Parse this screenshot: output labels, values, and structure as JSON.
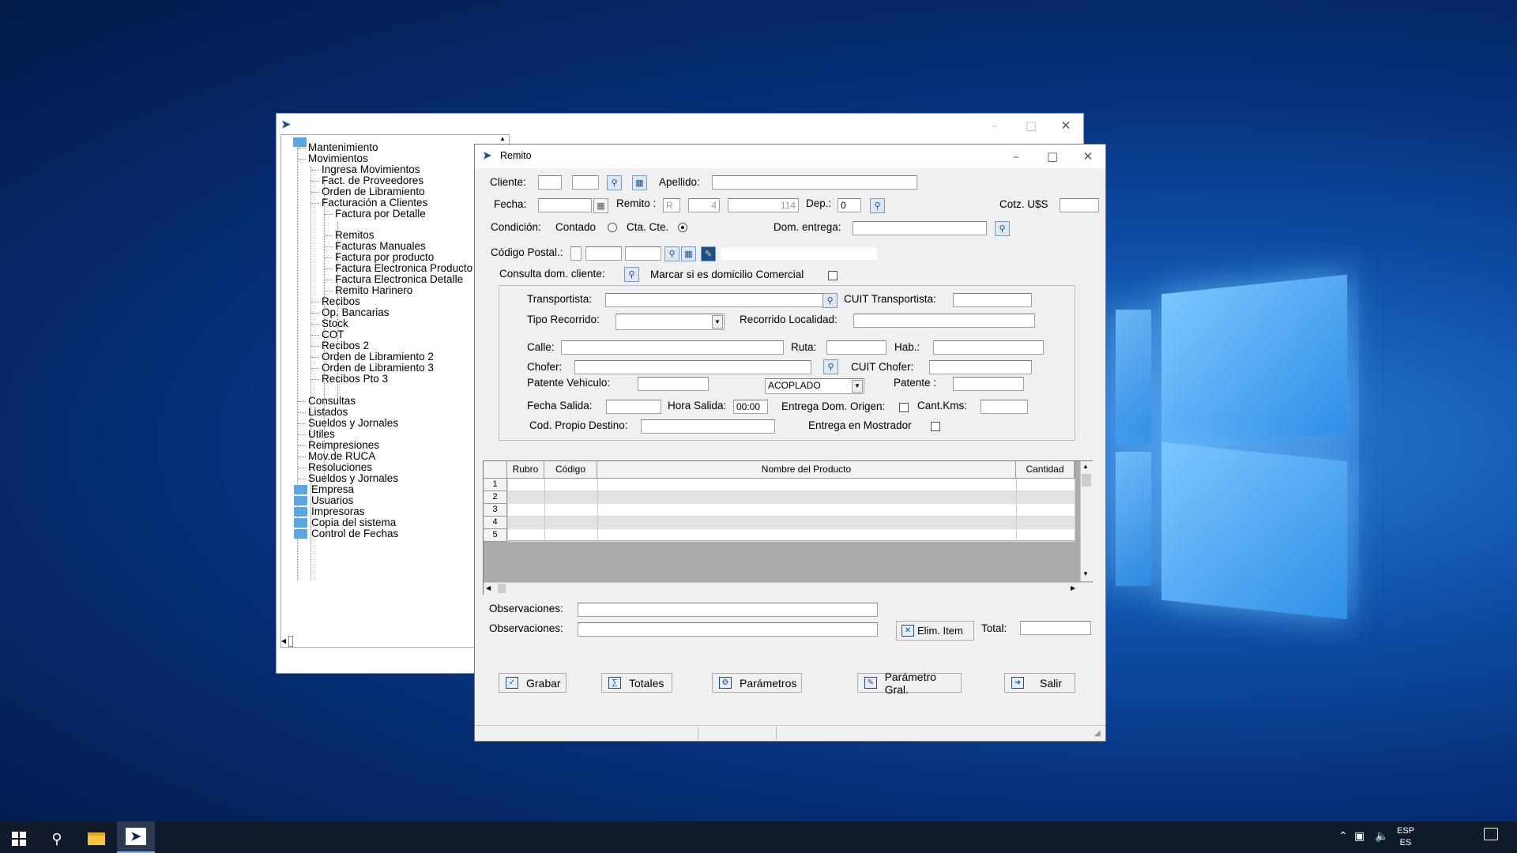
{
  "tree": {
    "items": [
      {
        "label": "Mantenimiento"
      },
      {
        "label": "Movimientos"
      },
      {
        "label": "Ingresa Movimientos"
      },
      {
        "label": "Fact. de Proveedores"
      },
      {
        "label": "Orden de Libramiento"
      },
      {
        "label": "Facturación a Clientes"
      },
      {
        "label": "Factura por Detalle"
      },
      {
        "label": "Remitos"
      },
      {
        "label": "Facturas Manuales"
      },
      {
        "label": "Factura por producto"
      },
      {
        "label": "Factura Electronica Producto"
      },
      {
        "label": "Factura Electronica Detalle"
      },
      {
        "label": "Remito Harinero"
      },
      {
        "label": "Recibos"
      },
      {
        "label": "Op. Bancarias"
      },
      {
        "label": "Stock"
      },
      {
        "label": "COT"
      },
      {
        "label": "Recibos 2"
      },
      {
        "label": "Orden de Libramiento 2"
      },
      {
        "label": "Orden de Libramiento 3"
      },
      {
        "label": "Recibos Pto 3"
      },
      {
        "label": "Consultas"
      },
      {
        "label": "Listados"
      },
      {
        "label": "Sueldos y Jornales"
      },
      {
        "label": "Utiles"
      },
      {
        "label": "Reimpresiones"
      },
      {
        "label": "Mov.de RUCA"
      },
      {
        "label": "Resoluciones"
      },
      {
        "label": "Sueldos y Jornales"
      },
      {
        "label": "Empresa"
      },
      {
        "label": "Usuarios"
      },
      {
        "label": "Impresoras"
      },
      {
        "label": "Copia del sistema"
      },
      {
        "label": "Control de Fechas"
      }
    ]
  },
  "remito": {
    "title": "Remito",
    "cliente_label": "Cliente:",
    "apellido_label": "Apellido:",
    "fecha_label": "Fecha:",
    "remito_label": "Remito :",
    "remito_letra": "R",
    "remito_pto": "4",
    "remito_num": "114",
    "dep_label": "Dep.:",
    "dep_value": "0",
    "cotz_label": "Cotz. U$S",
    "condicion_label": "Condición:",
    "contado_label": "Contado",
    "ctacte_label": "Cta. Cte.",
    "dom_entrega_label": "Dom. entrega:",
    "cp_label": "Código Postal.:",
    "consulta_label": "Consulta dom. cliente:",
    "marcar_label": "Marcar si es domicilio Comercial",
    "transportista_label": "Transportista:",
    "cuit_transp_label": "CUIT Transportista:",
    "tipo_recorrido_label": "Tipo Recorrido:",
    "recorrido_loc_label": "Recorrido Localidad:",
    "calle_label": "Calle:",
    "ruta_label": "Ruta:",
    "hab_label": "Hab.:",
    "chofer_label": "Chofer:",
    "cuit_chofer_label": "CUIT Chofer:",
    "patente_veh_label": "Patente Vehiculo:",
    "acoplado_value": "ACOPLADO",
    "patente_label": "Patente :",
    "fecha_salida_label": "Fecha Salida:",
    "hora_salida_label": "Hora Salida:",
    "hora_salida_value": "00:00",
    "entrega_origen_label": "Entrega Dom. Origen:",
    "cant_kms_label": "Cant.Kms:",
    "cod_destino_label": "Cod. Propio Destino:",
    "mostrador_label": "Entrega en Mostrador",
    "grid": {
      "columns": [
        "Rubro",
        "Código",
        "Nombre del Producto",
        "Cantidad"
      ],
      "rows": [
        "1",
        "2",
        "3",
        "4",
        "5"
      ]
    },
    "obs_label1": "Observaciones:",
    "obs_label2": "Observaciones:",
    "elim_label": "Elim. Item",
    "total_label": "Total:",
    "buttons": {
      "grabar": "Grabar",
      "totales": "Totales",
      "parametros": "Parámetros",
      "param_gral": "Parámetro Gral.",
      "salir": "Salir"
    }
  },
  "taskbar": {
    "lang1": "ESP",
    "lang2": "ES"
  }
}
